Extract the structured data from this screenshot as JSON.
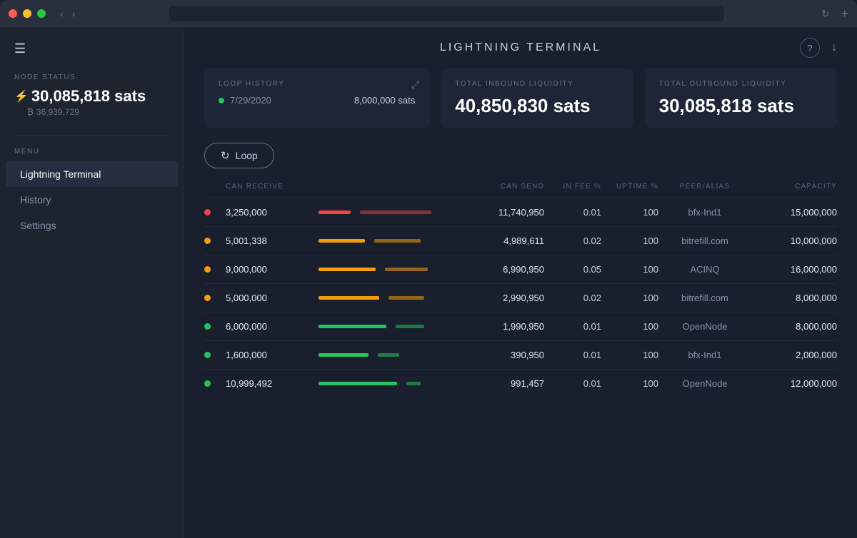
{
  "titlebar": {
    "plus_label": "+"
  },
  "sidebar": {
    "hamburger": "☰",
    "node_status_label": "NODE STATUS",
    "balance_sats": "30,085,818 sats",
    "balance_btc": "36,939,729",
    "menu_label": "MENU",
    "items": [
      {
        "id": "lightning-terminal",
        "label": "Lightning Terminal",
        "active": true
      },
      {
        "id": "history",
        "label": "History",
        "active": false
      },
      {
        "id": "settings",
        "label": "Settings",
        "active": false
      }
    ]
  },
  "header": {
    "title": "LIGHTNING TERMINAL"
  },
  "stats": {
    "loop_history_label": "LOOP HISTORY",
    "loop_date": "7/29/2020",
    "loop_amount": "8,000,000 sats",
    "inbound_label": "TOTAL INBOUND LIQUIDITY",
    "inbound_value": "40,850,830 sats",
    "outbound_label": "TOTAL OUTBOUND LIQUIDITY",
    "outbound_value": "30,085,818 sats"
  },
  "loop_button": "Loop",
  "table": {
    "headers": {
      "status": "",
      "can_receive": "CAN RECEIVE",
      "bar": "",
      "can_send": "CAN SEND",
      "in_fee": "IN FEE %",
      "uptime": "UPTIME %",
      "peer": "PEER/ALIAS",
      "capacity": "CAPACITY"
    },
    "rows": [
      {
        "status_class": "dot-online-red",
        "can_receive": "3,250,000",
        "can_send": "11,740,950",
        "in_fee": "0.01",
        "uptime": "100",
        "peer": "bfx-Ind1",
        "capacity": "15,000,000",
        "bar_type": "red",
        "bar_receive_w": 45,
        "bar_send_w": 100
      },
      {
        "status_class": "dot-online-yellow",
        "can_receive": "5,001,338",
        "can_send": "4,989,611",
        "in_fee": "0.02",
        "uptime": "100",
        "peer": "bitrefill.com",
        "capacity": "10,000,000",
        "bar_type": "yellow",
        "bar_receive_w": 65,
        "bar_send_w": 65
      },
      {
        "status_class": "dot-online-yellow",
        "can_receive": "9,000,000",
        "can_send": "6,990,950",
        "in_fee": "0.05",
        "uptime": "100",
        "peer": "ACINQ",
        "capacity": "16,000,000",
        "bar_type": "yellow",
        "bar_receive_w": 80,
        "bar_send_w": 60
      },
      {
        "status_class": "dot-online-yellow",
        "can_receive": "5,000,000",
        "can_send": "2,990,950",
        "in_fee": "0.02",
        "uptime": "100",
        "peer": "bitrefill.com",
        "capacity": "8,000,000",
        "bar_type": "yellow",
        "bar_receive_w": 85,
        "bar_send_w": 50
      },
      {
        "status_class": "dot-online-green",
        "can_receive": "6,000,000",
        "can_send": "1,990,950",
        "in_fee": "0.01",
        "uptime": "100",
        "peer": "OpenNode",
        "capacity": "8,000,000",
        "bar_type": "green",
        "bar_receive_w": 95,
        "bar_send_w": 40
      },
      {
        "status_class": "dot-online-green",
        "can_receive": "1,600,000",
        "can_send": "390,950",
        "in_fee": "0.01",
        "uptime": "100",
        "peer": "bfx-Ind1",
        "capacity": "2,000,000",
        "bar_type": "green",
        "bar_receive_w": 70,
        "bar_send_w": 30
      },
      {
        "status_class": "dot-online-green",
        "can_receive": "10,999,492",
        "can_send": "991,457",
        "in_fee": "0.01",
        "uptime": "100",
        "peer": "OpenNode",
        "capacity": "12,000,000",
        "bar_type": "green",
        "bar_receive_w": 110,
        "bar_send_w": 20
      }
    ]
  }
}
